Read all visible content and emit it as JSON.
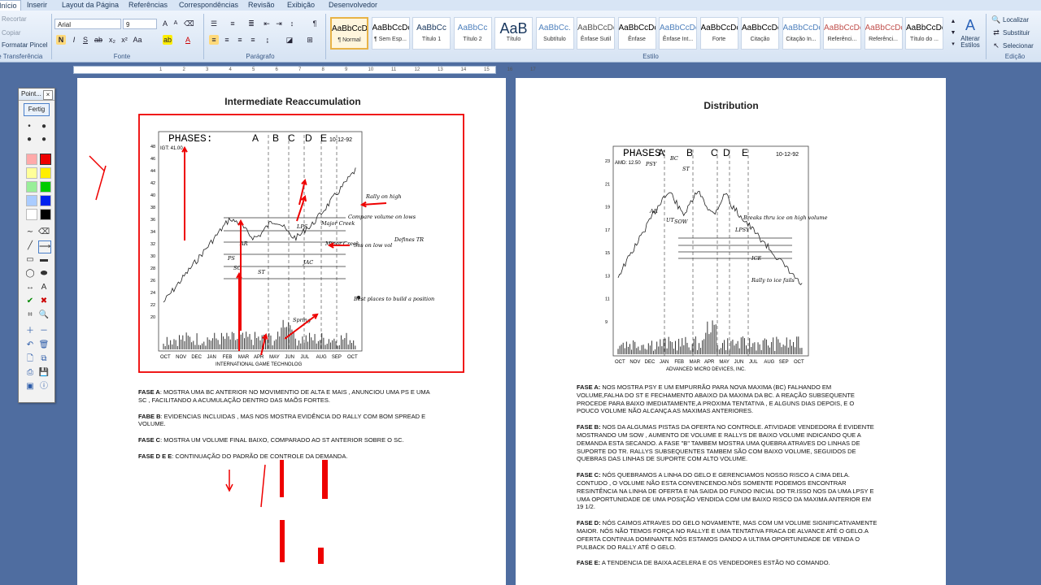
{
  "tabs": [
    "Início",
    "Inserir",
    "Layout da Página",
    "Referências",
    "Correspondências",
    "Revisão",
    "Exibição",
    "Desenvolvedor"
  ],
  "clipboard": {
    "cut": "Recortar",
    "copy": "Copiar",
    "format_painter": "Formatar Pincel",
    "group": "Área de Transferência"
  },
  "font": {
    "name": "Arial",
    "size": "9",
    "group": "Fonte"
  },
  "paragraph": {
    "group": "Parágrafo"
  },
  "styles": {
    "group": "Estilo",
    "items": [
      {
        "preview": "AaBbCcDc",
        "name": "¶ Normal",
        "color": "#000000"
      },
      {
        "preview": "AaBbCcDc",
        "name": "¶ Sem Esp...",
        "color": "#000000"
      },
      {
        "preview": "AaBbCc",
        "name": "Título 1",
        "color": "#17365d"
      },
      {
        "preview": "AaBbCc",
        "name": "Título 2",
        "color": "#4f81bd"
      },
      {
        "preview": "AaB",
        "name": "Título",
        "color": "#17365d"
      },
      {
        "preview": "AaBbCc.",
        "name": "Subtítulo",
        "color": "#4f81bd"
      },
      {
        "preview": "AaBbCcDc",
        "name": "Ênfase Sutil",
        "color": "#555555"
      },
      {
        "preview": "AaBbCcDc",
        "name": "Ênfase",
        "color": "#000000"
      },
      {
        "preview": "AaBbCcDc",
        "name": "Ênfase Int...",
        "color": "#4f81bd"
      },
      {
        "preview": "AaBbCcDc",
        "name": "Forte",
        "color": "#000000"
      },
      {
        "preview": "AaBbCcDc",
        "name": "Citação",
        "color": "#000000"
      },
      {
        "preview": "AaBbCcDc",
        "name": "Citação In...",
        "color": "#4f81bd"
      },
      {
        "preview": "AaBbCcDc",
        "name": "Referênci...",
        "color": "#c0504d"
      },
      {
        "preview": "AaBbCcDc",
        "name": "Referênci...",
        "color": "#c0504d"
      },
      {
        "preview": "AaBbCcDc",
        "name": "Título do ...",
        "color": "#000000"
      }
    ],
    "change": "Alterar Estilos"
  },
  "editing": {
    "find": "Localizar",
    "replace": "Substituir",
    "select": "Selecionar",
    "group": "Edição"
  },
  "pointer_tool": {
    "title": "Point...",
    "close": "×",
    "button": "Fertig"
  },
  "ruler": {
    "marks": [
      "1",
      "2",
      "3",
      "4",
      "5",
      "6",
      "7",
      "8",
      "9",
      "10",
      "11",
      "12",
      "13",
      "14",
      "15",
      "16",
      "17"
    ]
  },
  "left_page": {
    "chart_title": "Intermediate Reaccumulation",
    "paragraphs": [
      {
        "label": "FASE A",
        "text": ": MOSTRA UMA BC ANTERIOR NO MOVIMENTIO DE ALTA E MAIS , ANUNCIOU UMA PS E UMA SC , FACILITANDO A ACUMULAÇÃO DENTRO DAS MAÕS FORTES."
      },
      {
        "label": "FABE B",
        "text": ": EVIDENCIAS INCLUIDAS , MAS NOS MOSTRA EVIDÊNCIA DO RALLY COM BOM SPREAD E VOLUME."
      },
      {
        "label": "FASE C",
        "text": ": MOSTRA UM VOLUME FINAL BAIXO, COMPARADO AO ST ANTERIOR SOBRE O SC."
      },
      {
        "label": "FASE D e E",
        "text": ": CONTINUAÇÃO DO PADRÃO DE CONTROLE DA DEMANDA."
      }
    ],
    "chart_labels": {
      "phases": "PHASES:",
      "letters": [
        "A",
        "B",
        "C",
        "D",
        "E"
      ],
      "date": "10-12-92",
      "ticker": "IGT: 41.00",
      "footer": "INTERNATIONAL GAME TECHNOLOG",
      "months": [
        "OCT",
        "NOV",
        "DEC",
        "JAN",
        "FEB",
        "MAR",
        "APR",
        "MAY",
        "JUN",
        "JUL",
        "AUG",
        "SEP",
        "OCT"
      ],
      "notes": [
        "Defines TR",
        "Minor Creek",
        "Major Creek",
        "Best places to build a position",
        "Compare volume on lows",
        "Rally on high",
        "Sos on low vol",
        "LPS",
        "JAC",
        "PS",
        "SC",
        "AR",
        "ST",
        "Spring"
      ]
    }
  },
  "right_page": {
    "chart_title": "Distribution",
    "paragraphs": [
      {
        "label": "FASE A:",
        "text": " NOS MOSTRA PSY E UM EMPURRÃO PARA NOVA MAXIMA (BC) FALHANDO EM VOLUME,FALHA DO ST E FECHAMENTO ABAIXO DA MAXIMA DA BC. A REAÇÃO SUBSEQUENTE PROCEDE PARA BAIXO IMEDIATAMENTE,A PROXIMA TENTATIVA , E ALGUNS DIAS DEPOIS, E O POUCO VOLUME NÃO ALCANÇA AS MAXIMAS ANTERIORES."
      },
      {
        "label": "FASE B:",
        "text": " NOS DA ALGUMAS PISTAS DA OFERTA NO CONTROLE. ATIVIDADE VENDEDORA É EVIDENTE MOSTRANDO UM SOW , AUMENTO DE VOLUME E RALLYS DE BAIXO VOLUME INDICANDO QUE A DEMANDA ESTA SECANDO. A FASE \"B\" TAMBEM MOSTRA UMA QUEBRA ATRAVES DO LINHAS DE SUPORTE DO TR. RALLYS SUBSEQUENTES TAMBEM SÃO COM BAIXO VOLUME, SEGUIDOS DE QUEBRAS DAS LINHAS DE SUPORTE COM ALTO VOLUME."
      },
      {
        "label": "FASE C:",
        "text": " NÓS QUEBRAMOS A LINHA DO GELO E GERENCIAMOS NOSSO RISCO A CIMA DELA. CONTUDO , O VOLUME NÃO ESTA CONVENCENDO.NÓS SOMENTE PODEMOS ENCONTRAR RESINTÊNCIA NA LINHA DE OFERTA E NA SAIDA DO FUNDO INICIAL DO TR.ISSO NOS DA UMA LPSY E UMA OPORTUNIDADE DE UMA POSIÇÃO VENDIDA COM UM BAIXO RISCO DA MAXIMA ANTERIOR EM 19 1/2."
      },
      {
        "label": "FASE D:",
        "text": " NÓS CAIMOS ATRAVES DO GELO NOVAMENTE, MAS COM UM VOLUME SIGNIFICATIVAMENTE MAIOR. NÓS NÃO TEMOS FORÇA NO RALLYE E UMA TENTATIVA FRACA DE ALVANCE ATÉ O GELO.A OFERTA CONTINUA DOMINANTE.NÓS ESTAMOS DANDO A ULTIMA OPORTUNIDADE DE VENDA O PULBACK DO RALLY ATÉ O GELO."
      },
      {
        "label": "FASE E:",
        "text": " A TENDENCIA DE BAIXA ACELERA E OS VENDEDORES ESTÃO NO COMANDO."
      }
    ],
    "chart_labels": {
      "phases": "PHASES:",
      "letters": [
        "A",
        "B",
        "C",
        "D",
        "E"
      ],
      "date": "10-12-92",
      "ticker": "AMD: 12.50",
      "footer": "ADVANCED MICRO DEVICES, INC.",
      "months": [
        "OCT",
        "NOV",
        "DEC",
        "JAN",
        "FEB",
        "MAR",
        "APR",
        "MAY",
        "JUN",
        "JUL",
        "AUG",
        "SEP",
        "OCT"
      ],
      "notes": [
        "BC",
        "PSY",
        "ST",
        "SOW",
        "LPSY",
        "ICE",
        "Rally to ice fails",
        "AR",
        "UT",
        "Breaks thru ice on high volume"
      ]
    }
  }
}
